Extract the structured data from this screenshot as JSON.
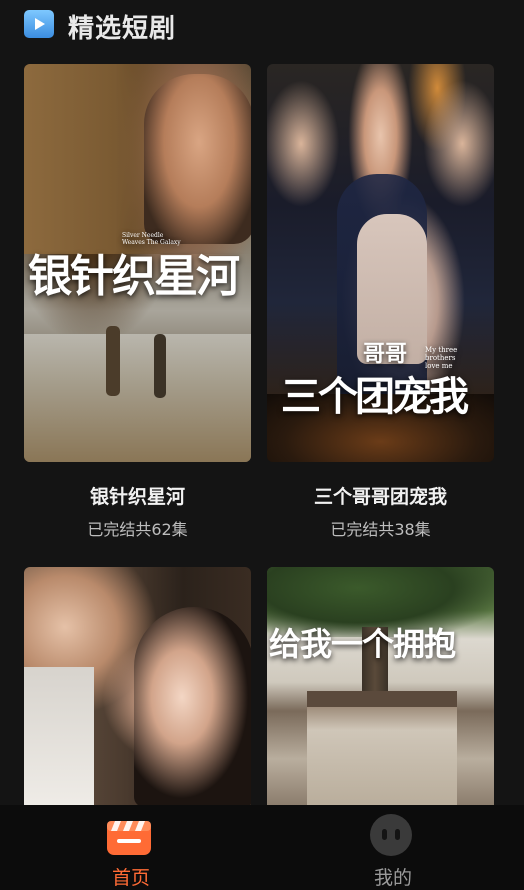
{
  "header": {
    "icon": "play-icon",
    "title": "精选短剧"
  },
  "dramas": [
    {
      "title": "银针织星河",
      "subtitle": "已完结共62集",
      "poster_text": "银针织星河",
      "poster_small_text": "Silver Needle Weaves The Galaxy"
    },
    {
      "title": "三个哥哥团宠我",
      "subtitle": "已完结共38集",
      "poster_text_top": "哥哥",
      "poster_text_main": "三个团宠我",
      "poster_small_text": "My three brothers love me"
    },
    {
      "title": "",
      "subtitle": ""
    },
    {
      "title": "",
      "subtitle": "",
      "poster_text": "给我一个拥抱"
    }
  ],
  "tabbar": {
    "tabs": [
      {
        "label": "首页",
        "icon": "clapperboard-icon",
        "active": true
      },
      {
        "label": "我的",
        "icon": "profile-face-icon",
        "active": false
      }
    ],
    "colors": {
      "active": "#ff6b35",
      "inactive": "#9a9a9a"
    }
  }
}
